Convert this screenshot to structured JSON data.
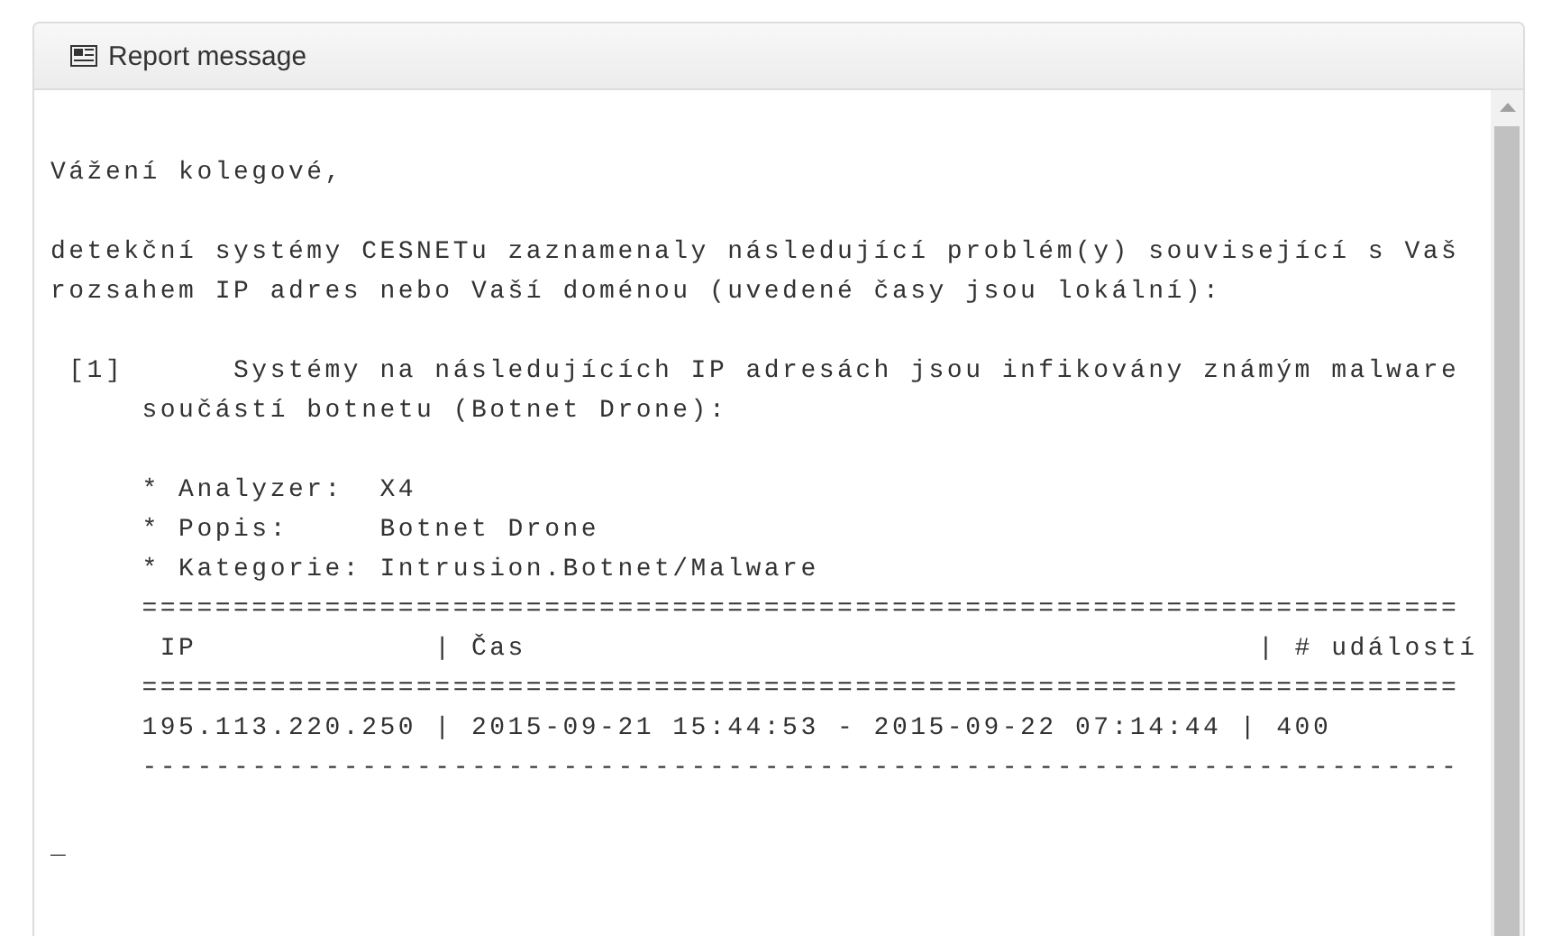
{
  "panel": {
    "title": "Report message"
  },
  "message": {
    "paragraphs": [
      [
        "Vážení kolegové,"
      ],
      [
        "detekční systémy CESNETu zaznamenaly následující problém(y) související s Vaš",
        "rozsahem IP adres nebo Vaší doménou (uvedené časy jsou lokální):"
      ],
      [
        " [1]      Systémy na následujících IP adresách jsou infikovány známým malware",
        "     součástí botnetu (Botnet Drone):"
      ],
      [
        "     * Analyzer:  X4",
        "     * Popis:     Botnet Drone",
        "     * Kategorie: Intrusion.Botnet/Malware",
        "     ========================================================================",
        "      IP             | Čas                                        | # událostí",
        "     ========================================================================",
        "     195.113.220.250 | 2015-09-21 15:44:53 - 2015-09-22 07:14:44 | 400",
        "     ------------------------------------------------------------------------"
      ],
      [
        "_"
      ]
    ]
  }
}
